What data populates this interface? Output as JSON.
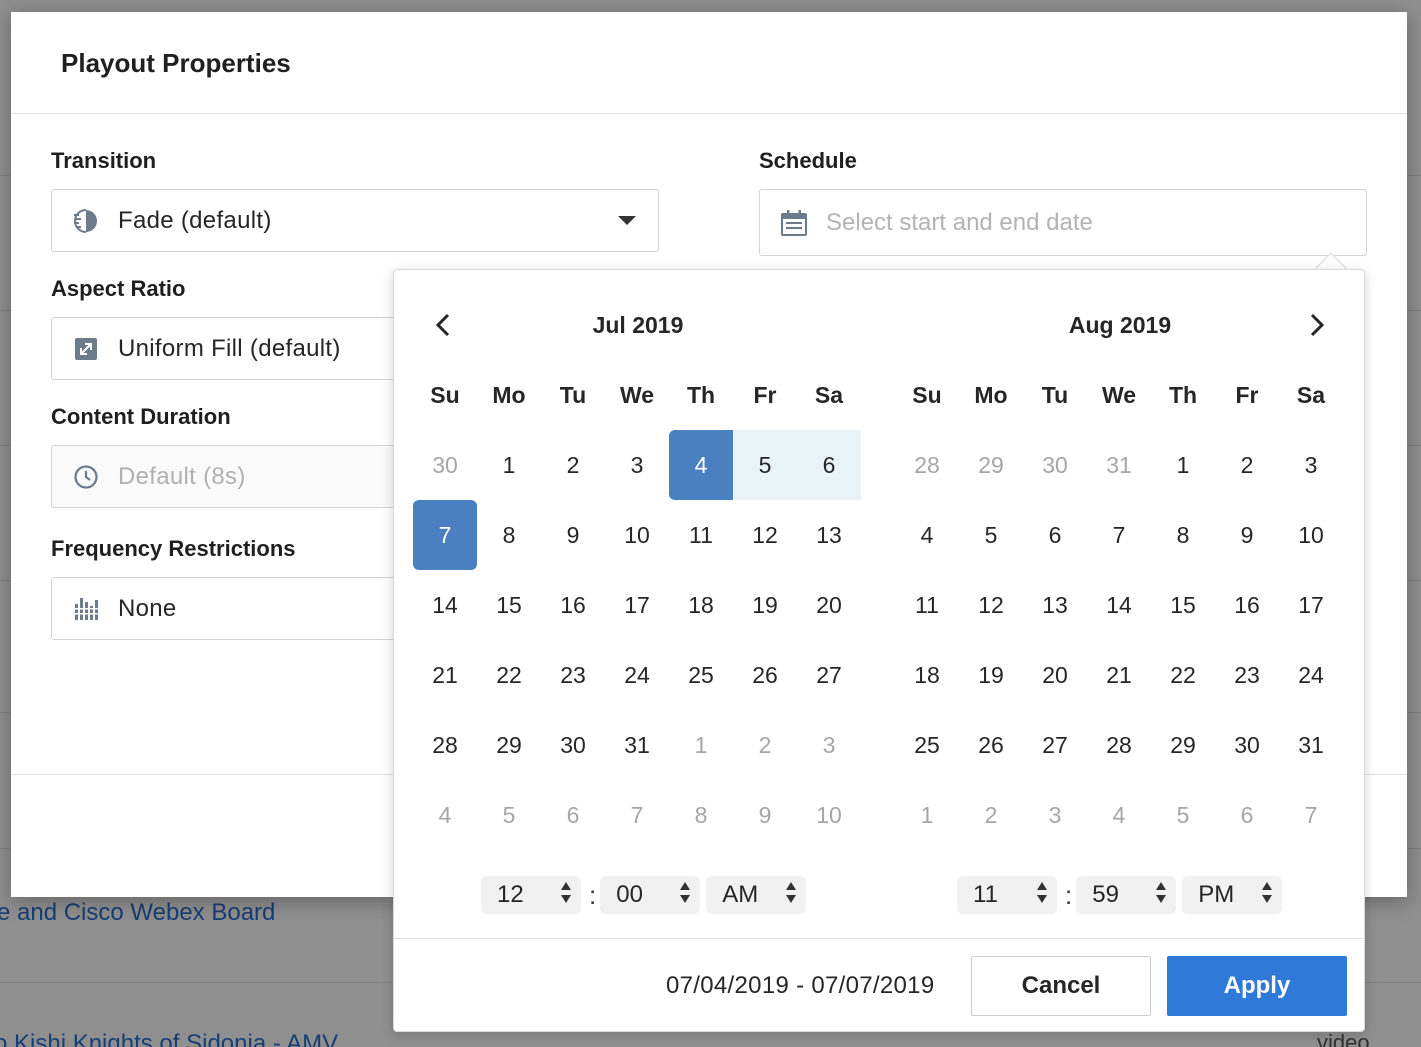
{
  "background": {
    "rows": [
      {
        "link": "e and Cisco Webex Board"
      },
      {
        "link": "o Kishi Knights of Sidonia - AMV",
        "type": "video"
      }
    ]
  },
  "modal": {
    "title": "Playout Properties",
    "transition": {
      "label": "Transition",
      "value": "Fade (default)",
      "icon": "fade-icon"
    },
    "aspect_ratio": {
      "label": "Aspect Ratio",
      "value": "Uniform Fill (default)",
      "icon": "expand-icon"
    },
    "content_duration": {
      "label": "Content Duration",
      "value": "Default (8s)",
      "icon": "clock-icon"
    },
    "frequency": {
      "label": "Frequency Restrictions",
      "value": "None",
      "icon": "frequency-bars-icon"
    },
    "schedule": {
      "label": "Schedule",
      "placeholder": "Select start and end date",
      "icon": "calendar-icon"
    }
  },
  "picker": {
    "weekdays": [
      "Su",
      "Mo",
      "Tu",
      "We",
      "Th",
      "Fr",
      "Sa"
    ],
    "months": [
      {
        "title": "Jul 2019",
        "weeks": [
          [
            {
              "d": "30",
              "out": true
            },
            {
              "d": "1"
            },
            {
              "d": "2"
            },
            {
              "d": "3"
            },
            {
              "d": "4",
              "sel": "start"
            },
            {
              "d": "5",
              "sel": "range"
            },
            {
              "d": "6",
              "sel": "range"
            }
          ],
          [
            {
              "d": "7",
              "sel": "end"
            },
            {
              "d": "8"
            },
            {
              "d": "9"
            },
            {
              "d": "10"
            },
            {
              "d": "11"
            },
            {
              "d": "12"
            },
            {
              "d": "13"
            }
          ],
          [
            {
              "d": "14"
            },
            {
              "d": "15"
            },
            {
              "d": "16"
            },
            {
              "d": "17"
            },
            {
              "d": "18"
            },
            {
              "d": "19"
            },
            {
              "d": "20"
            }
          ],
          [
            {
              "d": "21"
            },
            {
              "d": "22"
            },
            {
              "d": "23"
            },
            {
              "d": "24"
            },
            {
              "d": "25"
            },
            {
              "d": "26"
            },
            {
              "d": "27"
            }
          ],
          [
            {
              "d": "28"
            },
            {
              "d": "29"
            },
            {
              "d": "30"
            },
            {
              "d": "31"
            },
            {
              "d": "1",
              "out": true
            },
            {
              "d": "2",
              "out": true
            },
            {
              "d": "3",
              "out": true
            }
          ],
          [
            {
              "d": "4",
              "out": true
            },
            {
              "d": "5",
              "out": true
            },
            {
              "d": "6",
              "out": true
            },
            {
              "d": "7",
              "out": true
            },
            {
              "d": "8",
              "out": true
            },
            {
              "d": "9",
              "out": true
            },
            {
              "d": "10",
              "out": true
            }
          ]
        ],
        "time": {
          "hour": "12",
          "minute": "00",
          "ampm": "AM"
        }
      },
      {
        "title": "Aug 2019",
        "weeks": [
          [
            {
              "d": "28",
              "out": true
            },
            {
              "d": "29",
              "out": true
            },
            {
              "d": "30",
              "out": true
            },
            {
              "d": "31",
              "out": true
            },
            {
              "d": "1"
            },
            {
              "d": "2"
            },
            {
              "d": "3"
            }
          ],
          [
            {
              "d": "4"
            },
            {
              "d": "5"
            },
            {
              "d": "6"
            },
            {
              "d": "7"
            },
            {
              "d": "8"
            },
            {
              "d": "9"
            },
            {
              "d": "10"
            }
          ],
          [
            {
              "d": "11"
            },
            {
              "d": "12"
            },
            {
              "d": "13"
            },
            {
              "d": "14"
            },
            {
              "d": "15"
            },
            {
              "d": "16"
            },
            {
              "d": "17"
            }
          ],
          [
            {
              "d": "18"
            },
            {
              "d": "19"
            },
            {
              "d": "20"
            },
            {
              "d": "21"
            },
            {
              "d": "22"
            },
            {
              "d": "23"
            },
            {
              "d": "24"
            }
          ],
          [
            {
              "d": "25"
            },
            {
              "d": "26"
            },
            {
              "d": "27"
            },
            {
              "d": "28"
            },
            {
              "d": "29"
            },
            {
              "d": "30"
            },
            {
              "d": "31"
            }
          ],
          [
            {
              "d": "1",
              "out": true
            },
            {
              "d": "2",
              "out": true
            },
            {
              "d": "3",
              "out": true
            },
            {
              "d": "4",
              "out": true
            },
            {
              "d": "5",
              "out": true
            },
            {
              "d": "6",
              "out": true
            },
            {
              "d": "7",
              "out": true
            }
          ]
        ],
        "time": {
          "hour": "11",
          "minute": "59",
          "ampm": "PM"
        }
      }
    ],
    "range_text": "07/04/2019 - 07/07/2019",
    "cancel_label": "Cancel",
    "apply_label": "Apply"
  },
  "colors": {
    "accent": "#2f7ad9",
    "selected_day": "#4a80bf",
    "range_day": "#e8f2f7"
  }
}
